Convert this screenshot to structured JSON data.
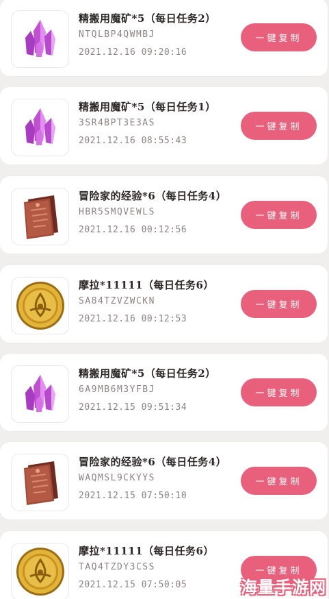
{
  "button_label": "一键复制",
  "watermark": "海量手游网",
  "colors": {
    "accent": "#e8607b",
    "background": "#f1eeee",
    "card": "#ffffff"
  },
  "items": [
    {
      "title": "精搬用魔矿*5（每日任务2）",
      "code": "NTQLBP4QWMBJ",
      "time": "2021.12.16 09:20:16",
      "icon": "crystal-icon"
    },
    {
      "title": "精搬用魔矿*5（每日任务1）",
      "code": "3SR4BPT3E3AS",
      "time": "2021.12.16 08:55:43",
      "icon": "crystal-icon"
    },
    {
      "title": "冒险家的经验*6（每日任务4）",
      "code": "HBR5SMQVEWLS",
      "time": "2021.12.16 00:12:56",
      "icon": "scroll-icon"
    },
    {
      "title": "摩拉*11111（每日任务6）",
      "code": "SA84TZVZWCKN",
      "time": "2021.12.16 00:12:53",
      "icon": "coin-icon"
    },
    {
      "title": "精搬用魔矿*5（每日任务2）",
      "code": "6A9MB6M3YFBJ",
      "time": "2021.12.15 09:51:34",
      "icon": "crystal-icon"
    },
    {
      "title": "冒险家的经验*6（每日任务4）",
      "code": "WAQMSL9CKYYS",
      "time": "2021.12.15 07:50:10",
      "icon": "scroll-icon"
    },
    {
      "title": "摩拉*11111（每日任务6）",
      "code": "TAQ4TZDY3CSS",
      "time": "2021.12.15 07:50:05",
      "icon": "coin-icon"
    }
  ]
}
